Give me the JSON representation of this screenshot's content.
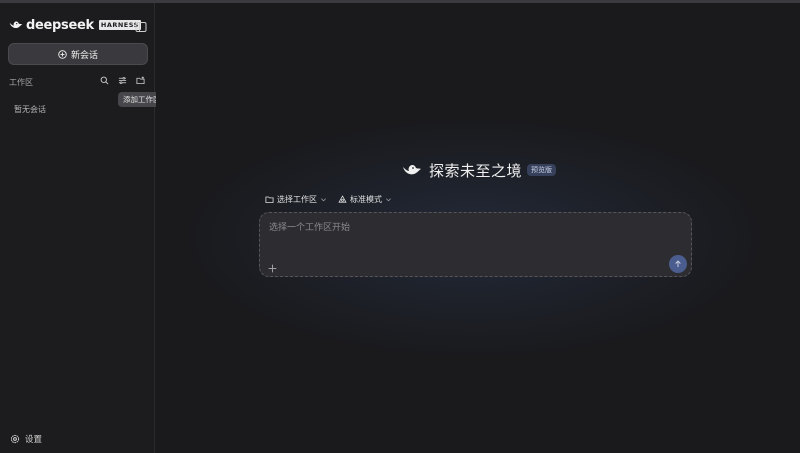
{
  "app": {
    "brand_name": "deepseek",
    "brand_badge": "HARNESS"
  },
  "sidebar": {
    "new_chat_label": "新会话",
    "workspace_label": "工作区",
    "add_workspace_tooltip": "添加工作区",
    "empty_state": "暂无会话",
    "settings_label": "设置",
    "icons": {
      "collapse": "sidebar-toggle-icon",
      "new_chat": "plus-circle-icon",
      "search": "search-icon",
      "filter": "filter-icon",
      "add_workspace": "folder-plus-icon",
      "settings": "gear-icon"
    }
  },
  "main": {
    "hero_title": "探索未至之境",
    "hero_badge": "预览版",
    "workspace_selector": "选择工作区",
    "mode_selector": "标准模式",
    "composer_placeholder": "选择一个工作区开始",
    "composer_value": "",
    "icons": {
      "hero_logo": "whale-logo-icon",
      "workspace_selector": "folder-icon",
      "mode_selector": "recycle-icon",
      "attach": "plus-icon",
      "send": "arrow-up-icon"
    }
  },
  "colors": {
    "background": "#1a1a1c",
    "sidebar": "#1c1c1e",
    "accent": "#4a5d8e",
    "badge_bg": "#36405a"
  }
}
